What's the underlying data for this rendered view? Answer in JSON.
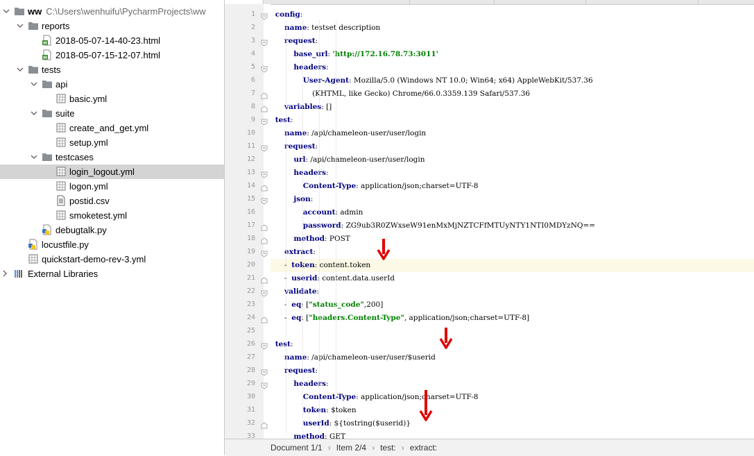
{
  "project_tree": {
    "root_name": "ww",
    "root_path": "C:\\Users\\wenhuifu\\PycharmProjects\\ww",
    "items": [
      {
        "label": "reports",
        "kind": "folder",
        "expanded": true
      },
      {
        "label": "2018-05-07-14-40-23.html",
        "kind": "html-file"
      },
      {
        "label": "2018-05-07-15-12-07.html",
        "kind": "html-file"
      },
      {
        "label": "tests",
        "kind": "folder",
        "expanded": true
      },
      {
        "label": "api",
        "kind": "folder",
        "expanded": true
      },
      {
        "label": "basic.yml",
        "kind": "yml-file"
      },
      {
        "label": "suite",
        "kind": "folder",
        "expanded": true
      },
      {
        "label": "create_and_get.yml",
        "kind": "yml-file"
      },
      {
        "label": "setup.yml",
        "kind": "yml-file"
      },
      {
        "label": "testcases",
        "kind": "folder",
        "expanded": true
      },
      {
        "label": "login_logout.yml",
        "kind": "yml-file",
        "selected": true
      },
      {
        "label": "logon.yml",
        "kind": "yml-file"
      },
      {
        "label": "postid.csv",
        "kind": "csv-file"
      },
      {
        "label": "smoketest.yml",
        "kind": "yml-file"
      },
      {
        "label": "debugtalk.py",
        "kind": "python-file"
      },
      {
        "label": "locustfile.py",
        "kind": "python-file"
      },
      {
        "label": "quickstart-demo-rev-3.yml",
        "kind": "yml-file"
      },
      {
        "label": "External Libraries",
        "kind": "library",
        "expanded": false
      }
    ]
  },
  "editor": {
    "current_line": 20,
    "lines": [
      {
        "n": "1",
        "indent": 0,
        "parts": [
          [
            "k",
            "config"
          ],
          [
            "t",
            ":"
          ]
        ]
      },
      {
        "n": "2",
        "indent": 1,
        "parts": [
          [
            "k",
            "name"
          ],
          [
            "t",
            ": testset description"
          ]
        ]
      },
      {
        "n": "3",
        "indent": 1,
        "parts": [
          [
            "k",
            "request"
          ],
          [
            "t",
            ":"
          ]
        ]
      },
      {
        "n": "4",
        "indent": 2,
        "parts": [
          [
            "k",
            "base_url"
          ],
          [
            "t",
            ": "
          ],
          [
            "s",
            "'http://172.16.78.73:3011'"
          ]
        ]
      },
      {
        "n": "5",
        "indent": 2,
        "parts": [
          [
            "k",
            "headers"
          ],
          [
            "t",
            ":"
          ]
        ]
      },
      {
        "n": "6",
        "indent": 3,
        "parts": [
          [
            "k",
            "User-Agent"
          ],
          [
            "t",
            ": Mozilla/5.0 (Windows NT 10.0; Win64; x64) AppleWebKit/537.36"
          ]
        ]
      },
      {
        "n": "7",
        "indent": 4,
        "parts": [
          [
            "t",
            "(KHTML, like Gecko) Chrome/66.0.3359.139 Safari/537.36"
          ]
        ]
      },
      {
        "n": "8",
        "indent": 1,
        "parts": [
          [
            "k",
            "variables"
          ],
          [
            "t",
            ": []"
          ]
        ]
      },
      {
        "n": "9",
        "indent": 0,
        "parts": [
          [
            "k",
            "test"
          ],
          [
            "t",
            ":"
          ]
        ]
      },
      {
        "n": "10",
        "indent": 1,
        "parts": [
          [
            "k",
            "name"
          ],
          [
            "t",
            ": /api/chameleon-user/user/login"
          ]
        ]
      },
      {
        "n": "11",
        "indent": 1,
        "parts": [
          [
            "k",
            "request"
          ],
          [
            "t",
            ":"
          ]
        ]
      },
      {
        "n": "12",
        "indent": 2,
        "parts": [
          [
            "k",
            "url"
          ],
          [
            "t",
            ": /api/chameleon-user/user/login"
          ]
        ]
      },
      {
        "n": "13",
        "indent": 2,
        "parts": [
          [
            "k",
            "headers"
          ],
          [
            "t",
            ":"
          ]
        ]
      },
      {
        "n": "14",
        "indent": 3,
        "parts": [
          [
            "k",
            "Content-Type"
          ],
          [
            "t",
            ": application/json;charset=UTF-8"
          ]
        ]
      },
      {
        "n": "15",
        "indent": 2,
        "parts": [
          [
            "k",
            "json"
          ],
          [
            "t",
            ":"
          ]
        ]
      },
      {
        "n": "16",
        "indent": 3,
        "parts": [
          [
            "k",
            "account"
          ],
          [
            "t",
            ": admin"
          ]
        ]
      },
      {
        "n": "17",
        "indent": 3,
        "parts": [
          [
            "k",
            "password"
          ],
          [
            "t",
            ": ZG9ub3R0ZWxseW91enMxMjNZTCFfMTUyNTY1NTI0MDYzNQ=="
          ]
        ]
      },
      {
        "n": "18",
        "indent": 2,
        "parts": [
          [
            "k",
            "method"
          ],
          [
            "t",
            ": POST"
          ]
        ]
      },
      {
        "n": "19",
        "indent": 1,
        "parts": [
          [
            "k",
            "extract"
          ],
          [
            "t",
            ":"
          ]
        ]
      },
      {
        "n": "20",
        "indent": 1,
        "parts": [
          [
            "t",
            "-  "
          ],
          [
            "k",
            "token"
          ],
          [
            "t",
            ": content.token"
          ]
        ]
      },
      {
        "n": "21",
        "indent": 1,
        "parts": [
          [
            "t",
            "-  "
          ],
          [
            "k",
            "userid"
          ],
          [
            "t",
            ": content.data.userId"
          ]
        ]
      },
      {
        "n": "22",
        "indent": 1,
        "parts": [
          [
            "k",
            "validate"
          ],
          [
            "t",
            ":"
          ]
        ]
      },
      {
        "n": "23",
        "indent": 1,
        "parts": [
          [
            "t",
            "-  "
          ],
          [
            "k",
            "eq"
          ],
          [
            "t",
            ": ["
          ],
          [
            "s",
            "\"status_code\""
          ],
          [
            "t",
            ",200]"
          ]
        ]
      },
      {
        "n": "24",
        "indent": 1,
        "parts": [
          [
            "t",
            "-  "
          ],
          [
            "k",
            "eq"
          ],
          [
            "t",
            ": ["
          ],
          [
            "s",
            "\"headers.Content-Type\""
          ],
          [
            "t",
            ", application/json;charset=UTF-8]"
          ]
        ]
      },
      {
        "n": "25",
        "indent": 0,
        "parts": []
      },
      {
        "n": "26",
        "indent": 0,
        "parts": [
          [
            "k",
            "test"
          ],
          [
            "t",
            ":"
          ]
        ]
      },
      {
        "n": "27",
        "indent": 1,
        "parts": [
          [
            "k",
            "name"
          ],
          [
            "t",
            ": /api/chameleon-user/user/$userid"
          ]
        ]
      },
      {
        "n": "28",
        "indent": 1,
        "parts": [
          [
            "k",
            "request"
          ],
          [
            "t",
            ":"
          ]
        ]
      },
      {
        "n": "29",
        "indent": 2,
        "parts": [
          [
            "k",
            "headers"
          ],
          [
            "t",
            ":"
          ]
        ]
      },
      {
        "n": "30",
        "indent": 3,
        "parts": [
          [
            "k",
            "Content-Type"
          ],
          [
            "t",
            ": application/json;charset=UTF-8"
          ]
        ]
      },
      {
        "n": "31",
        "indent": 3,
        "parts": [
          [
            "k",
            "token"
          ],
          [
            "t",
            ": $token"
          ]
        ]
      },
      {
        "n": "32",
        "indent": 3,
        "parts": [
          [
            "k",
            "userId"
          ],
          [
            "t",
            ": ${tostring($userid)}"
          ]
        ]
      },
      {
        "n": "33",
        "indent": 2,
        "parts": [
          [
            "k",
            "method"
          ],
          [
            "t",
            ": GET"
          ]
        ]
      }
    ]
  },
  "status_bar": {
    "crumbs": [
      "Document 1/1",
      "Item 2/4",
      "test:",
      "extract:"
    ]
  },
  "colors": {
    "keyword": "#000080",
    "string": "#008000",
    "current_line": "#fcfae7",
    "selection": "#d4d4d4",
    "annotation_arrow": "#e00000"
  }
}
